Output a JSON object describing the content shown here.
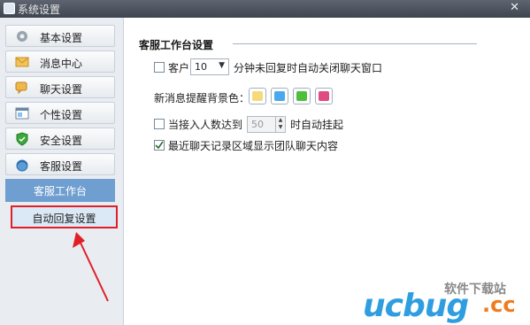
{
  "window": {
    "title": "系统设置"
  },
  "sidebar": {
    "items": [
      {
        "label": "基本设置",
        "icon": "gear-icon"
      },
      {
        "label": "消息中心",
        "icon": "envelope-icon"
      },
      {
        "label": "聊天设置",
        "icon": "chat-bubble-icon"
      },
      {
        "label": "个性设置",
        "icon": "personalize-icon"
      },
      {
        "label": "安全设置",
        "icon": "shield-icon"
      },
      {
        "label": "客服设置",
        "icon": "customer-service-icon"
      }
    ],
    "subitems": [
      {
        "label": "客服工作台",
        "state": "selected"
      },
      {
        "label": "自动回复设置",
        "state": "highlighted"
      }
    ]
  },
  "main": {
    "section_title": "客服工作台设置",
    "auto_close": {
      "prefix": "客户",
      "minutes": "10",
      "suffix": "分钟未回复时自动关闭聊天窗口",
      "checked": false
    },
    "bg_color": {
      "label": "新消息提醒背景色：",
      "colors": [
        "#f7d97a",
        "#4aa8ec",
        "#4fbf3a",
        "#e04a82"
      ]
    },
    "auto_hangup": {
      "prefix": "当接入人数达到",
      "count": "50",
      "suffix": "时自动挂起",
      "checked": false
    },
    "show_team_chat": {
      "label": "最近聊天记录区域显示团队聊天内容",
      "checked": true
    }
  },
  "watermark": {
    "sub": "软件下载站",
    "main": "ucbug",
    "tld": ".cc"
  },
  "colors": {
    "accent": "#6f9ed0",
    "highlight_border": "#e01f26",
    "watermark_blue": "#2e9ee0",
    "watermark_orange": "#f07b1c"
  }
}
